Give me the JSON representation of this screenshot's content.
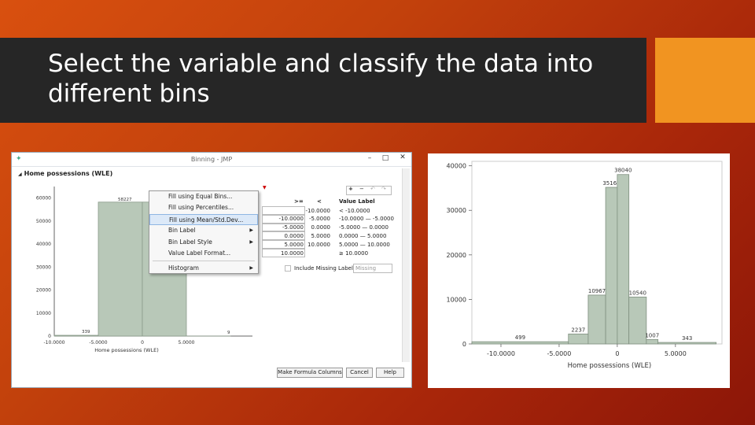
{
  "slide": {
    "title": "Select the variable and classify the data into different bins"
  },
  "window": {
    "title": "Binning - JMP",
    "controls": [
      "–",
      "□",
      "✕"
    ],
    "outline_title": "Home possessions (WLE)",
    "menu": {
      "items": [
        {
          "label": "Fill using Equal Bins...",
          "submenu": false,
          "highlighted": false
        },
        {
          "label": "Fill using Percentiles...",
          "submenu": false,
          "highlighted": false
        },
        {
          "label": "Fill using Mean/Std.Dev...",
          "submenu": false,
          "highlighted": true
        },
        {
          "label": "Bin Label",
          "submenu": true,
          "highlighted": false
        },
        {
          "label": "Bin Label Style",
          "submenu": true,
          "highlighted": false
        },
        {
          "label": "Value Label Format...",
          "submenu": false,
          "highlighted": false
        },
        {
          "label": "Histogram",
          "submenu": true,
          "highlighted": false
        }
      ]
    },
    "mini_hist": {
      "y_ticks": [
        "60000",
        "50000",
        "40000",
        "30000",
        "20000",
        "10000",
        "0"
      ],
      "x_ticks": [
        "-10.0000",
        "-5.0000",
        "0",
        "5.0000"
      ],
      "xlabel": "Home possessions (WLE)",
      "labels": [
        "339",
        "58227",
        "9"
      ]
    },
    "table": {
      "headers": [
        ">=",
        "<",
        "Value Label"
      ],
      "rows": [
        [
          "",
          "-10.0000",
          "< -10.0000"
        ],
        [
          "-10.0000",
          "-5.0000",
          "-10.0000 — -5.0000"
        ],
        [
          "-5.0000",
          "0.0000",
          "-5.0000 — 0.0000"
        ],
        [
          "0.0000",
          "5.0000",
          "0.0000 — 5.0000"
        ],
        [
          "5.0000",
          "10.0000",
          "5.0000 — 10.0000"
        ],
        [
          "10.0000",
          "",
          "≥ 10.0000"
        ]
      ],
      "tools": [
        "+",
        "−",
        "↶",
        "↷"
      ]
    },
    "include_missing_label": "Include Missing Label",
    "missing_placeholder": "Missing",
    "buttons": [
      "Make Formula Columns",
      "Cancel",
      "Help"
    ]
  },
  "chart_data": {
    "type": "bar",
    "xlabel": "Home possessions (WLE)",
    "ylabel": "",
    "x_ticks": [
      "-10.0000",
      "-5.0000",
      "0",
      "5.0000"
    ],
    "y_ticks": [
      "40000",
      "30000",
      "20000",
      "10000",
      "0"
    ],
    "ylim": [
      0,
      41000
    ],
    "bins": [
      {
        "from": -12.5,
        "to": -4.2,
        "value": 499,
        "label": "499"
      },
      {
        "from": -4.2,
        "to": -2.5,
        "value": 2237,
        "label": "2237"
      },
      {
        "from": -2.5,
        "to": -1.0,
        "value": 10967,
        "label": "10967"
      },
      {
        "from": -1.0,
        "to": 0.0,
        "value": 35160,
        "label": "35160"
      },
      {
        "from": 0.0,
        "to": 1.0,
        "value": 38040,
        "label": "38040"
      },
      {
        "from": 1.0,
        "to": 2.5,
        "value": 10540,
        "label": "10540"
      },
      {
        "from": 2.5,
        "to": 3.5,
        "value": 1007,
        "label": "1007"
      },
      {
        "from": 3.5,
        "to": 8.5,
        "value": 343,
        "label": "343"
      }
    ],
    "bar_color": "#b8c8b8"
  }
}
